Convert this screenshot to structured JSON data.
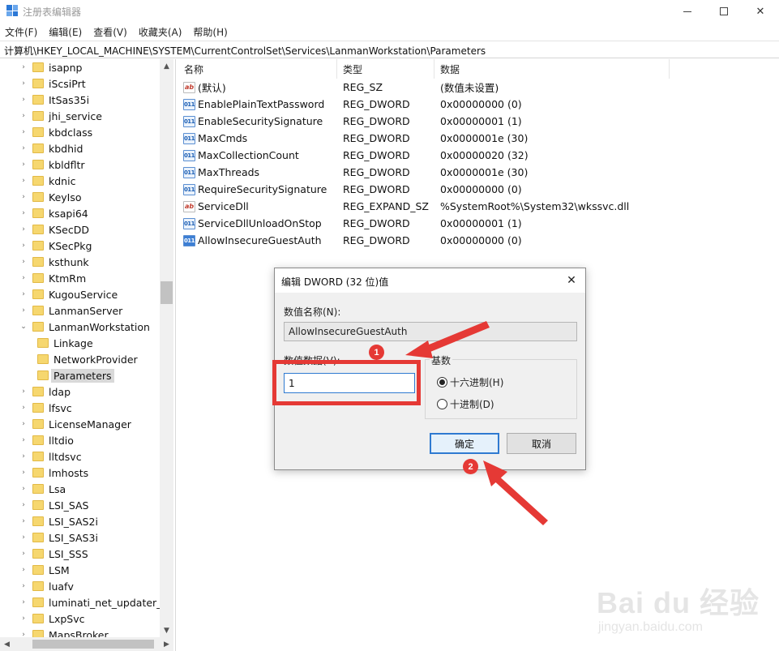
{
  "window": {
    "title": "注册表编辑器",
    "minimize_icon": "minimize-icon",
    "maximize_icon": "maximize-icon",
    "close_icon": "close-icon"
  },
  "menu": [
    "文件(F)",
    "编辑(E)",
    "查看(V)",
    "收藏夹(A)",
    "帮助(H)"
  ],
  "address": "计算机\\HKEY_LOCAL_MACHINE\\SYSTEM\\CurrentControlSet\\Services\\LanmanWorkstation\\Parameters",
  "tree": [
    {
      "label": "isapnp",
      "level": 0
    },
    {
      "label": "iScsiPrt",
      "level": 0
    },
    {
      "label": "ItSas35i",
      "level": 0
    },
    {
      "label": "jhi_service",
      "level": 0
    },
    {
      "label": "kbdclass",
      "level": 0
    },
    {
      "label": "kbdhid",
      "level": 0
    },
    {
      "label": "kbldfltr",
      "level": 0
    },
    {
      "label": "kdnic",
      "level": 0
    },
    {
      "label": "KeyIso",
      "level": 0
    },
    {
      "label": "ksapi64",
      "level": 0
    },
    {
      "label": "KSecDD",
      "level": 0
    },
    {
      "label": "KSecPkg",
      "level": 0
    },
    {
      "label": "ksthunk",
      "level": 0
    },
    {
      "label": "KtmRm",
      "level": 0
    },
    {
      "label": "KugouService",
      "level": 0
    },
    {
      "label": "LanmanServer",
      "level": 0
    },
    {
      "label": "LanmanWorkstation",
      "level": 0,
      "expanded": true
    },
    {
      "label": "Linkage",
      "level": 1
    },
    {
      "label": "NetworkProvider",
      "level": 1
    },
    {
      "label": "Parameters",
      "level": 1,
      "selected": true
    },
    {
      "label": "ldap",
      "level": 0
    },
    {
      "label": "lfsvc",
      "level": 0
    },
    {
      "label": "LicenseManager",
      "level": 0
    },
    {
      "label": "lltdio",
      "level": 0
    },
    {
      "label": "lltdsvc",
      "level": 0
    },
    {
      "label": "lmhosts",
      "level": 0
    },
    {
      "label": "Lsa",
      "level": 0
    },
    {
      "label": "LSI_SAS",
      "level": 0
    },
    {
      "label": "LSI_SAS2i",
      "level": 0
    },
    {
      "label": "LSI_SAS3i",
      "level": 0
    },
    {
      "label": "LSI_SSS",
      "level": 0
    },
    {
      "label": "LSM",
      "level": 0
    },
    {
      "label": "luafv",
      "level": 0
    },
    {
      "label": "luminati_net_updater_wi",
      "level": 0
    },
    {
      "label": "LxpSvc",
      "level": 0
    },
    {
      "label": "MapsBroker",
      "level": 0
    }
  ],
  "columns": {
    "name": "名称",
    "type": "类型",
    "data": "数据"
  },
  "values": [
    {
      "icon": "string-value-icon",
      "name": "(默认)",
      "type": "REG_SZ",
      "data": "(数值未设置)"
    },
    {
      "icon": "dword-value-icon",
      "name": "EnablePlainTextPassword",
      "type": "REG_DWORD",
      "data": "0x00000000 (0)"
    },
    {
      "icon": "dword-value-icon",
      "name": "EnableSecuritySignature",
      "type": "REG_DWORD",
      "data": "0x00000001 (1)"
    },
    {
      "icon": "dword-value-icon",
      "name": "MaxCmds",
      "type": "REG_DWORD",
      "data": "0x0000001e (30)"
    },
    {
      "icon": "dword-value-icon",
      "name": "MaxCollectionCount",
      "type": "REG_DWORD",
      "data": "0x00000020 (32)"
    },
    {
      "icon": "dword-value-icon",
      "name": "MaxThreads",
      "type": "REG_DWORD",
      "data": "0x0000001e (30)"
    },
    {
      "icon": "dword-value-icon",
      "name": "RequireSecuritySignature",
      "type": "REG_DWORD",
      "data": "0x00000000 (0)"
    },
    {
      "icon": "string-value-icon",
      "name": "ServiceDll",
      "type": "REG_EXPAND_SZ",
      "data": "%SystemRoot%\\System32\\wkssvc.dll"
    },
    {
      "icon": "dword-value-icon",
      "name": "ServiceDllUnloadOnStop",
      "type": "REG_DWORD",
      "data": "0x00000001 (1)"
    },
    {
      "icon": "dword-value-icon",
      "name": "AllowInsecureGuestAuth",
      "type": "REG_DWORD",
      "data": "0x00000000 (0)"
    }
  ],
  "dialog": {
    "title": "编辑 DWORD (32 位)值",
    "name_label": "数值名称(N):",
    "name_value": "AllowInsecureGuestAuth",
    "data_label": "数值数据(V):",
    "data_value": "1",
    "base_label": "基数",
    "radio_hex": "十六进制(H)",
    "radio_dec": "十进制(D)",
    "selected_base": "hex",
    "ok": "确定",
    "cancel": "取消"
  },
  "annotations": {
    "badge1": "1",
    "badge2": "2",
    "color": "#e53935"
  },
  "watermark": {
    "logo": "Bai du 经验",
    "sub": "jingyan.baidu.com"
  }
}
